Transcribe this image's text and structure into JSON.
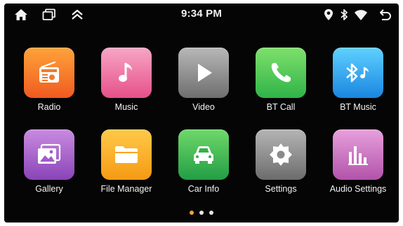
{
  "status_bar": {
    "time": "9:34 PM",
    "left_icons": [
      "home-icon",
      "recent-apps-icon",
      "collapse-icon"
    ],
    "right_icons": [
      "location-icon",
      "bluetooth-icon",
      "wifi-icon",
      "back-icon"
    ]
  },
  "apps": [
    {
      "label": "Radio",
      "icon": "radio-icon",
      "color_top": "#ffa33a",
      "color_bottom": "#f05a20"
    },
    {
      "label": "Music",
      "icon": "music-note-icon",
      "color_top": "#f7a6c4",
      "color_bottom": "#e6508a"
    },
    {
      "label": "Video",
      "icon": "play-icon",
      "color_top": "#b8b8b8",
      "color_bottom": "#6e6e6e"
    },
    {
      "label": "BT Call",
      "icon": "phone-icon",
      "color_top": "#7fe06c",
      "color_bottom": "#2fb448"
    },
    {
      "label": "BT Music",
      "icon": "bluetooth-music-icon",
      "color_top": "#5fd1ff",
      "color_bottom": "#1a86e0"
    },
    {
      "label": "Gallery",
      "icon": "gallery-icon",
      "color_top": "#c98be0",
      "color_bottom": "#8a44b8"
    },
    {
      "label": "File Manager",
      "icon": "folder-icon",
      "color_top": "#ffc94a",
      "color_bottom": "#f59a14"
    },
    {
      "label": "Car Info",
      "icon": "car-icon",
      "color_top": "#6fd86a",
      "color_bottom": "#229e45"
    },
    {
      "label": "Settings",
      "icon": "gear-icon",
      "color_top": "#b5b5b5",
      "color_bottom": "#6c6c6c"
    },
    {
      "label": "Audio Settings",
      "icon": "equalizer-icon",
      "color_top": "#e7a0dc",
      "color_bottom": "#b253aa"
    }
  ],
  "pagination": {
    "page_count": 3,
    "active_page": 1
  }
}
